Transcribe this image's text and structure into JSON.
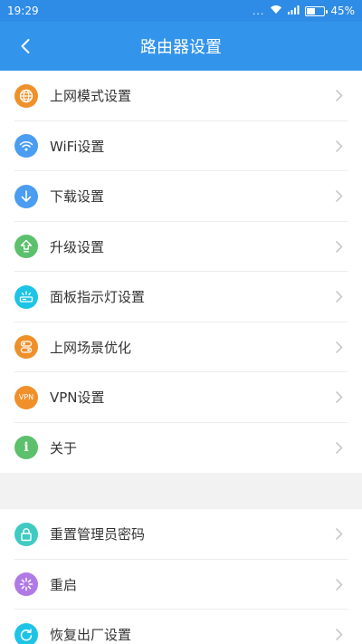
{
  "status_bar": {
    "time": "19:29",
    "dots": "...",
    "battery": "45%",
    "battery_level": 0.45
  },
  "header": {
    "title": "路由器设置"
  },
  "colors": {
    "header": "#3394ec",
    "status": "#2f8ce6",
    "orange": "#f0902a",
    "blue": "#4a9df0",
    "green": "#5cc06c",
    "cyan": "#1ec4e6",
    "teal": "#3fcbc1",
    "purple": "#b07ae6"
  },
  "sections": [
    {
      "items": [
        {
          "label": "上网模式设置",
          "icon": "globe-icon"
        },
        {
          "label": "WiFi设置",
          "icon": "wifi-icon"
        },
        {
          "label": "下载设置",
          "icon": "download-icon"
        },
        {
          "label": "升级设置",
          "icon": "upgrade-icon"
        },
        {
          "label": "面板指示灯设置",
          "icon": "indicator-light-icon"
        },
        {
          "label": "上网场景优化",
          "icon": "toggle-icon"
        },
        {
          "label": "VPN设置",
          "icon": "vpn-icon",
          "icon_text": "VPN"
        },
        {
          "label": "关于",
          "icon": "info-icon",
          "icon_text": "i"
        }
      ]
    },
    {
      "items": [
        {
          "label": "重置管理员密码",
          "icon": "lock-icon"
        },
        {
          "label": "重启",
          "icon": "restart-icon"
        },
        {
          "label": "恢复出厂设置",
          "icon": "factory-reset-icon"
        }
      ]
    }
  ]
}
